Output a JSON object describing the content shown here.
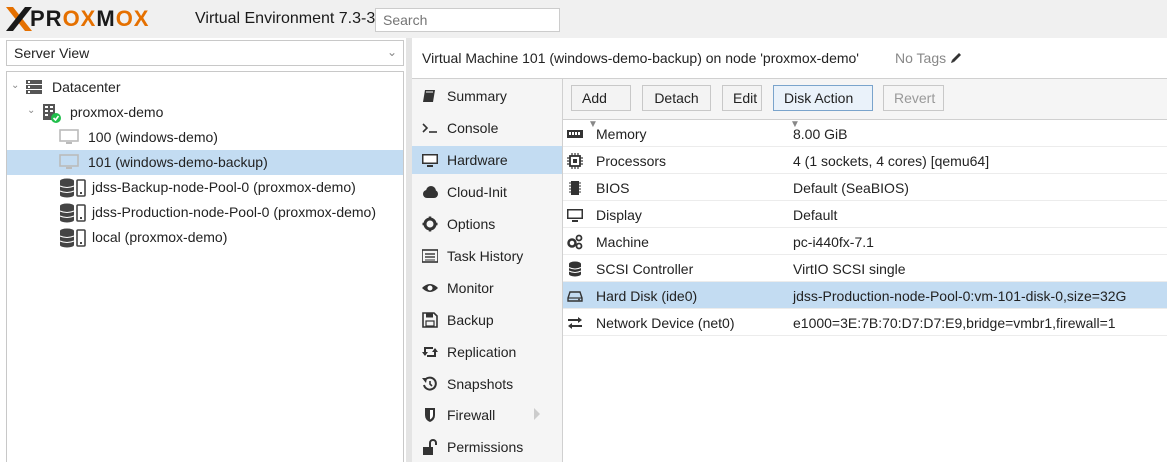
{
  "header": {
    "brand_prefix": "PR",
    "brand_ox1": "OX",
    "brand_m": "M",
    "brand_ox2": "OX",
    "product": "Virtual Environment 7.3-3",
    "search_placeholder": "Search"
  },
  "sidebar": {
    "view": "Server View",
    "tree": [
      {
        "label": "Datacenter",
        "icon": "datacenter-icon"
      },
      {
        "label": "proxmox-demo",
        "icon": "node-online-icon"
      },
      {
        "label": "100 (windows-demo)",
        "icon": "vm-stopped-icon"
      },
      {
        "label": "101 (windows-demo-backup)",
        "icon": "vm-stopped-icon",
        "selected": true
      },
      {
        "label": "jdss-Backup-node-Pool-0 (proxmox-demo)",
        "icon": "storage-icon"
      },
      {
        "label": "jdss-Production-node-Pool-0 (proxmox-demo)",
        "icon": "storage-icon"
      },
      {
        "label": "local (proxmox-demo)",
        "icon": "storage-icon"
      }
    ]
  },
  "main": {
    "title": "Virtual Machine 101 (windows-demo-backup) on node 'proxmox-demo'",
    "tags": "No Tags",
    "nav": [
      {
        "label": "Summary",
        "icon": "book-icon"
      },
      {
        "label": "Console",
        "icon": "terminal-icon"
      },
      {
        "label": "Hardware",
        "icon": "desktop-icon",
        "active": true
      },
      {
        "label": "Cloud-Init",
        "icon": "cloud-icon"
      },
      {
        "label": "Options",
        "icon": "gear-icon"
      },
      {
        "label": "Task History",
        "icon": "list-icon"
      },
      {
        "label": "Monitor",
        "icon": "eye-icon"
      },
      {
        "label": "Backup",
        "icon": "floppy-icon"
      },
      {
        "label": "Replication",
        "icon": "retweet-icon"
      },
      {
        "label": "Snapshots",
        "icon": "history-icon"
      },
      {
        "label": "Firewall",
        "icon": "shield-icon"
      },
      {
        "label": "Permissions",
        "icon": "unlock-icon"
      }
    ],
    "toolbar": {
      "add": "Add",
      "detach": "Detach",
      "edit": "Edit",
      "disk_action": "Disk Action",
      "revert": "Revert"
    },
    "hardware": [
      {
        "key": "Memory",
        "value": "8.00 GiB",
        "icon": "memory-icon"
      },
      {
        "key": "Processors",
        "value": "4 (1 sockets, 4 cores) [qemu64]",
        "icon": "cpu-icon"
      },
      {
        "key": "BIOS",
        "value": "Default (SeaBIOS)",
        "icon": "microchip-icon"
      },
      {
        "key": "Display",
        "value": "Default",
        "icon": "desktop-icon"
      },
      {
        "key": "Machine",
        "value": "pc-i440fx-7.1",
        "icon": "cogs-icon"
      },
      {
        "key": "SCSI Controller",
        "value": "VirtIO SCSI single",
        "icon": "database-icon"
      },
      {
        "key": "Hard Disk (ide0)",
        "value": "jdss-Production-node-Pool-0:vm-101-disk-0,size=32G",
        "icon": "hdd-icon",
        "selected": true
      },
      {
        "key": "Network Device (net0)",
        "value": "e1000=3E:7B:70:D7:D7:E9,bridge=vmbr1,firewall=1",
        "icon": "exchange-icon"
      }
    ]
  }
}
